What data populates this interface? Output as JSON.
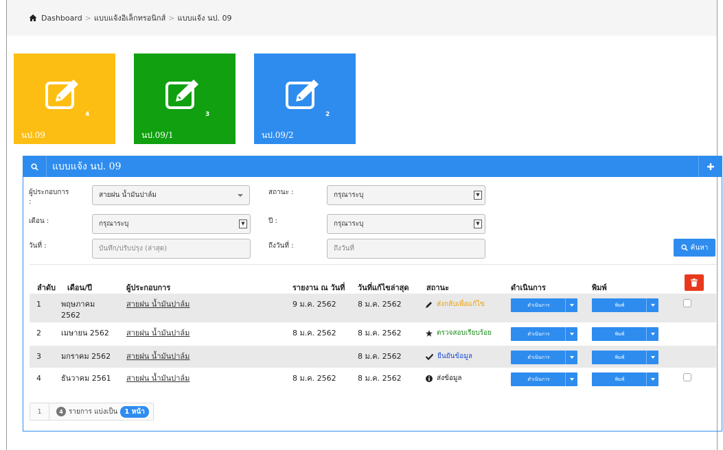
{
  "breadcrumb": {
    "items": [
      "Dashboard",
      "แบบแจ้งอิเล็กทรอนิกส์",
      "แบบแจ้ง นป. 09"
    ],
    "separator": ">"
  },
  "tiles": [
    {
      "label": "นป.09",
      "count": "4",
      "color": "#fdbe14"
    },
    {
      "label": "นป.09/1",
      "count": "3",
      "color": "#10a010"
    },
    {
      "label": "นป.09/2",
      "count": "2",
      "color": "#2e8cef"
    }
  ],
  "panel": {
    "title": "แบบแจ้ง นป. 09",
    "accent": "#2e8cef"
  },
  "filters": {
    "operator": {
      "label": "ผู้ประกอบการ :",
      "value": "สายฝน น้ำมันปาล์ม"
    },
    "status": {
      "label": "สถานะ :",
      "value": "กรุณาระบุ"
    },
    "month": {
      "label": "เดือน :",
      "value": "กรุณาระบุ"
    },
    "year": {
      "label": "ปี :",
      "value": "กรุณาระบุ"
    },
    "date_from": {
      "label": "วันที่ :",
      "placeholder": "บันทึก/ปรับปรุง (ล่าสุด)"
    },
    "date_to": {
      "label": "ถึงวันที่ :",
      "placeholder": "ถึงวันที่"
    },
    "search_label": "ค้นหา"
  },
  "table": {
    "headers": [
      "ลำดับ",
      "เดือน/ปี",
      "ผู้ประกอบการ",
      "รายงาน ณ วันที่",
      "วันที่แก้ไขล่าสุด",
      "สถานะ",
      "ดำเนินการ",
      "พิมพ์"
    ],
    "action_label": "ดำเนินการ",
    "print_label": "พิมพ์",
    "rows": [
      {
        "no": "1",
        "month_l1": "พฤษภาคม",
        "month_l2": "2562",
        "operator": "สายฝน น้ำมันปาล์ม",
        "report_date": "9 ม.ค. 2562",
        "edit_date": "8 ม.ค. 2562",
        "status": "ส่งกลับเพื่อแก้ไข",
        "status_icon": "pencil-icon",
        "status_color": "#f0a000",
        "checkbox": true
      },
      {
        "no": "2",
        "month_l1": "เมษายน 2562",
        "month_l2": "",
        "operator": "สายฝน น้ำมันปาล์ม",
        "report_date": "8 ม.ค. 2562",
        "edit_date": "8 ม.ค. 2562",
        "status": "ตรวจสอบเรียบร้อย",
        "status_icon": "star-icon",
        "status_color": "#1a8c1a",
        "checkbox": false
      },
      {
        "no": "3",
        "month_l1": "มกราคม 2562",
        "month_l2": "",
        "operator": "สายฝน น้ำมันปาล์ม",
        "report_date": "",
        "edit_date": "8 ม.ค. 2562",
        "status": "ยืนยันข้อมูล",
        "status_icon": "check-icon",
        "status_color": "#1a4fd0",
        "checkbox": false
      },
      {
        "no": "4",
        "month_l1": "ธันวาคม 2561",
        "month_l2": "",
        "operator": "สายฝน น้ำมันปาล์ม",
        "report_date": "8 ม.ค. 2562",
        "edit_date": "8 ม.ค. 2562",
        "status": "ส่งข้อมูล",
        "status_icon": "info-icon",
        "status_color": "#222222",
        "checkbox": true
      }
    ]
  },
  "pager": {
    "page": "1",
    "count": "4",
    "text1": "รายการ แบ่งเป็น",
    "pages": "1 หน้า"
  }
}
